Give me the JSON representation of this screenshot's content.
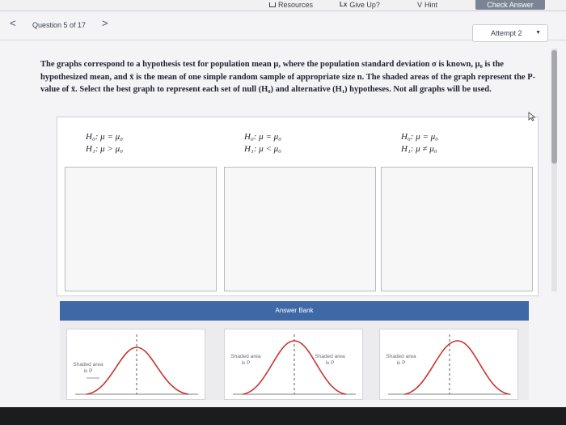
{
  "toolbar": {
    "resources_label": "Resources",
    "giveup_label": "Give Up?",
    "giveup_glyph": "Lx",
    "hint_label": "Hint",
    "hint_glyph": "V",
    "check_answer_label": "Check Answer"
  },
  "nav": {
    "prev_glyph": "<",
    "question_label": "Question 5 of 17",
    "next_glyph": ">",
    "attempt_label": "Attempt 2"
  },
  "question": {
    "prompt": "The graphs correspond to a hypothesis test for population mean μ, where the population standard deviation σ is known, μ₀ is the hypothesized mean, and x̄ is the mean of one simple random sample of appropriate size n. The shaded areas of the graph represent the P-value of x̄. Select the best graph to represent each set of null (H₀) and alternative (H₁) hypotheses. Not all graphs will be used.",
    "hypotheses": [
      {
        "h0": "H₀: μ = μ₀",
        "h1": "H₁: μ > μ₀"
      },
      {
        "h0": "H₀: μ = μ₀",
        "h1": "H₁: μ < μ₀"
      },
      {
        "h0": "H₀: μ = μ₀",
        "h1": "H₁: μ ≠ μ₀"
      }
    ]
  },
  "answer_bank": {
    "title": "Answer Bank",
    "cards": [
      {
        "label_line1": "Shaded area",
        "label_line2": "is P"
      },
      {
        "label_line1": "Shaded area",
        "label_line2": "is P",
        "label_line3": "Shaded area",
        "label_line4": "is P"
      },
      {
        "label_line1": "Shaded area",
        "label_line2": "is P"
      }
    ]
  },
  "colors": {
    "curve": "#c8322e",
    "bank_header": "#3f68a6",
    "check_answer": "#7b8495"
  }
}
